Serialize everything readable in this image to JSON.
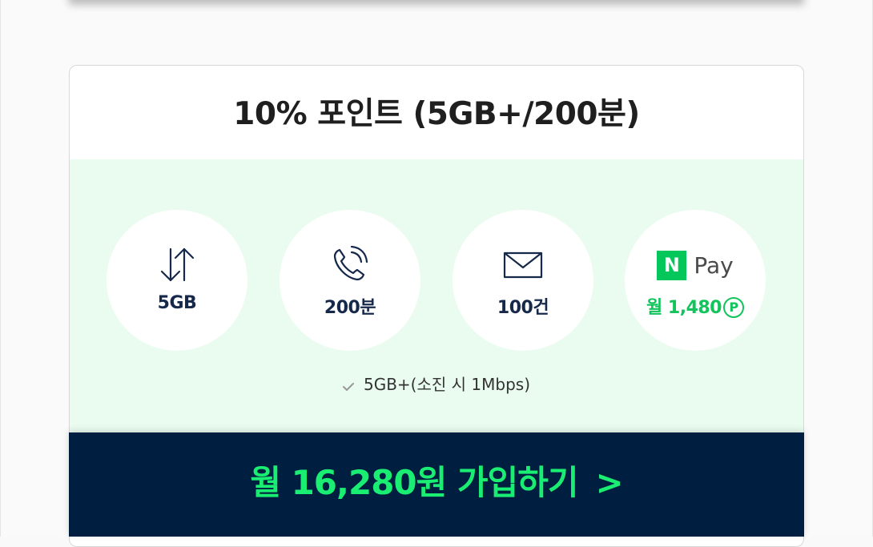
{
  "plan": {
    "title": "10% 포인트 (5GB+/200분)",
    "benefits": [
      {
        "icon": "data-transfer-icon",
        "label": "5GB"
      },
      {
        "icon": "phone-call-icon",
        "label": "200분"
      },
      {
        "icon": "mail-icon",
        "label": "100건"
      },
      {
        "icon": "naver-pay-logo",
        "logo_letter": "N",
        "logo_text": "Pay",
        "label": "월 1,480",
        "unit_symbol": "P"
      }
    ],
    "note": "5GB+(소진 시 1Mbps)"
  },
  "cta": {
    "label": "월 16,280원 가입하기",
    "arrow": ">"
  },
  "colors": {
    "accent_green": "#1aee72",
    "navy": "#001e40",
    "mint_background": "#eafcf0",
    "naver_green": "#03c75a"
  }
}
